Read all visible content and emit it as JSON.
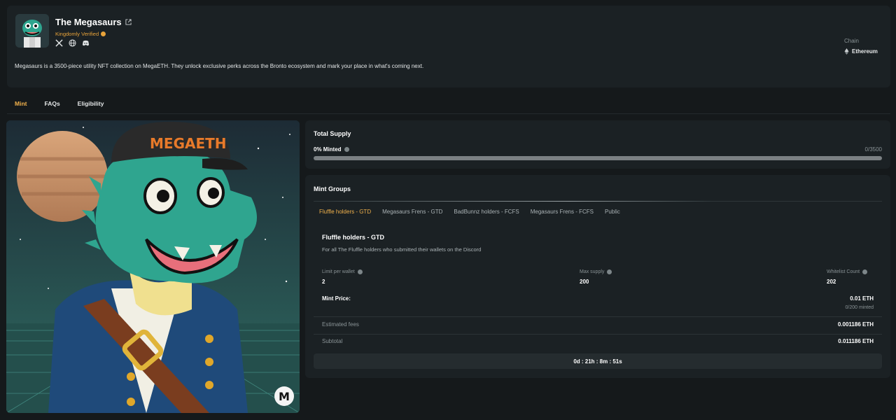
{
  "collection": {
    "title": "The Megasaurs",
    "verified_label": "Kingdomly Verified",
    "description": "Megasaurs is a 3500-piece utility NFT collection on MegaETH. They unlock exclusive perks across the Bronto ecosystem and mark your place in what's coming next.",
    "socials": [
      "x-icon",
      "globe-icon",
      "discord-icon"
    ],
    "chain_label": "Chain",
    "chain_value": "Ethereum",
    "art_cap_text": "MEGAETH",
    "art_badge": "M"
  },
  "tabs": [
    "Mint",
    "FAQs",
    "Eligibility"
  ],
  "active_tab": "Mint",
  "supply": {
    "title": "Total Supply",
    "minted_label": "0% Minted",
    "minted_count": "0/3500",
    "progress_fraction": 0
  },
  "mint_groups": {
    "title": "Mint Groups",
    "tabs": [
      "Fluffle holders - GTD",
      "Megasaurs Frens - GTD",
      "BadBunnz holders - FCFS",
      "Megasaurs Frens - FCFS",
      "Public"
    ],
    "active": {
      "name": "Fluffle holders - GTD",
      "description": "For all The Fluffle holders who submitted their wallets on the Discord",
      "limit_label": "Limit per wallet",
      "limit_value": "2",
      "max_supply_label": "Max supply",
      "max_supply_value": "200",
      "whitelist_label": "Whitelist Count",
      "whitelist_value": "202",
      "price_label": "Mint Price:",
      "price_value": "0.01 ETH",
      "price_minted": "0/200 minted",
      "fees_label": "Estimated fees",
      "fees_value": "0.001186 ETH",
      "subtotal_label": "Subtotal",
      "subtotal_value": "0.011186 ETH",
      "countdown": "0d : 21h : 8m : 51s"
    }
  },
  "colors": {
    "accent": "#f2b24c",
    "verified": "#e8a33a",
    "card_bg": "#1b2124",
    "page_bg": "#15191b"
  }
}
